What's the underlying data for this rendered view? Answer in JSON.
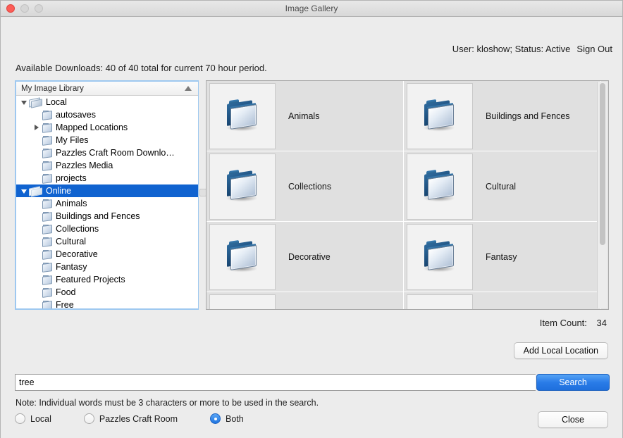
{
  "window": {
    "title": "Image Gallery",
    "traffic": {
      "close": "close-button",
      "minimize": "minimize-button",
      "maximize": "maximize-button"
    }
  },
  "header": {
    "user_status": "User: kloshow; Status: Active",
    "sign_out": "Sign Out",
    "downloads": "Available Downloads: 40 of 40 total for current 70 hour period."
  },
  "tree": {
    "header_title": "My Image Library",
    "sort_indicator": "sort-ascending-icon",
    "nodes": [
      {
        "label": "Local",
        "level": 1,
        "disclosure": "open",
        "icon": "open-folder-icon",
        "selected": false
      },
      {
        "label": "autosaves",
        "level": 2,
        "disclosure": "none",
        "icon": "folder-icon",
        "selected": false
      },
      {
        "label": "Mapped Locations",
        "level": 2,
        "disclosure": "closed",
        "icon": "folder-icon",
        "selected": false
      },
      {
        "label": "My Files",
        "level": 2,
        "disclosure": "none",
        "icon": "folder-icon",
        "selected": false
      },
      {
        "label": "Pazzles Craft Room Downlo…",
        "level": 2,
        "disclosure": "none",
        "icon": "folder-icon",
        "selected": false
      },
      {
        "label": "Pazzles Media",
        "level": 2,
        "disclosure": "none",
        "icon": "folder-icon",
        "selected": false
      },
      {
        "label": "projects",
        "level": 2,
        "disclosure": "none",
        "icon": "folder-icon",
        "selected": false
      },
      {
        "label": "Online",
        "level": 1,
        "disclosure": "open",
        "icon": "open-folder-icon",
        "selected": true
      },
      {
        "label": "Animals",
        "level": 2,
        "disclosure": "none",
        "icon": "folder-icon",
        "selected": false
      },
      {
        "label": "Buildings and Fences",
        "level": 2,
        "disclosure": "none",
        "icon": "folder-icon",
        "selected": false
      },
      {
        "label": "Collections",
        "level": 2,
        "disclosure": "none",
        "icon": "folder-icon",
        "selected": false
      },
      {
        "label": "Cultural",
        "level": 2,
        "disclosure": "none",
        "icon": "folder-icon",
        "selected": false
      },
      {
        "label": "Decorative",
        "level": 2,
        "disclosure": "none",
        "icon": "folder-icon",
        "selected": false
      },
      {
        "label": "Fantasy",
        "level": 2,
        "disclosure": "none",
        "icon": "folder-icon",
        "selected": false
      },
      {
        "label": "Featured Projects",
        "level": 2,
        "disclosure": "none",
        "icon": "folder-icon",
        "selected": false
      },
      {
        "label": "Food",
        "level": 2,
        "disclosure": "none",
        "icon": "folder-icon",
        "selected": false
      },
      {
        "label": "Free",
        "level": 2,
        "disclosure": "none",
        "icon": "folder-icon",
        "selected": false
      }
    ]
  },
  "grid": {
    "items": [
      {
        "label": "Animals",
        "icon": "folder-icon"
      },
      {
        "label": "Buildings and Fences",
        "icon": "folder-icon"
      },
      {
        "label": "Collections",
        "icon": "folder-icon"
      },
      {
        "label": "Cultural",
        "icon": "folder-icon"
      },
      {
        "label": "Decorative",
        "icon": "folder-icon"
      },
      {
        "label": "Fantasy",
        "icon": "folder-icon"
      },
      {
        "label": "",
        "icon": "folder-icon"
      },
      {
        "label": "",
        "icon": "folder-icon"
      }
    ]
  },
  "status": {
    "item_count_label": "Item Count:",
    "item_count_value": "34"
  },
  "buttons": {
    "add_local_location": "Add Local Location",
    "search": "Search",
    "close": "Close"
  },
  "search": {
    "value": "tree",
    "placeholder": "",
    "note": "Note:  Individual words must be 3 characters or more to be used in the search.",
    "scope": [
      {
        "label": "Local",
        "selected": false
      },
      {
        "label": "Pazzles Craft Room",
        "selected": false
      },
      {
        "label": "Both",
        "selected": true
      }
    ]
  },
  "colors": {
    "selection_blue": "#1063d0",
    "default_button_blue": "#2a7ce8",
    "window_bg": "#ececec"
  }
}
